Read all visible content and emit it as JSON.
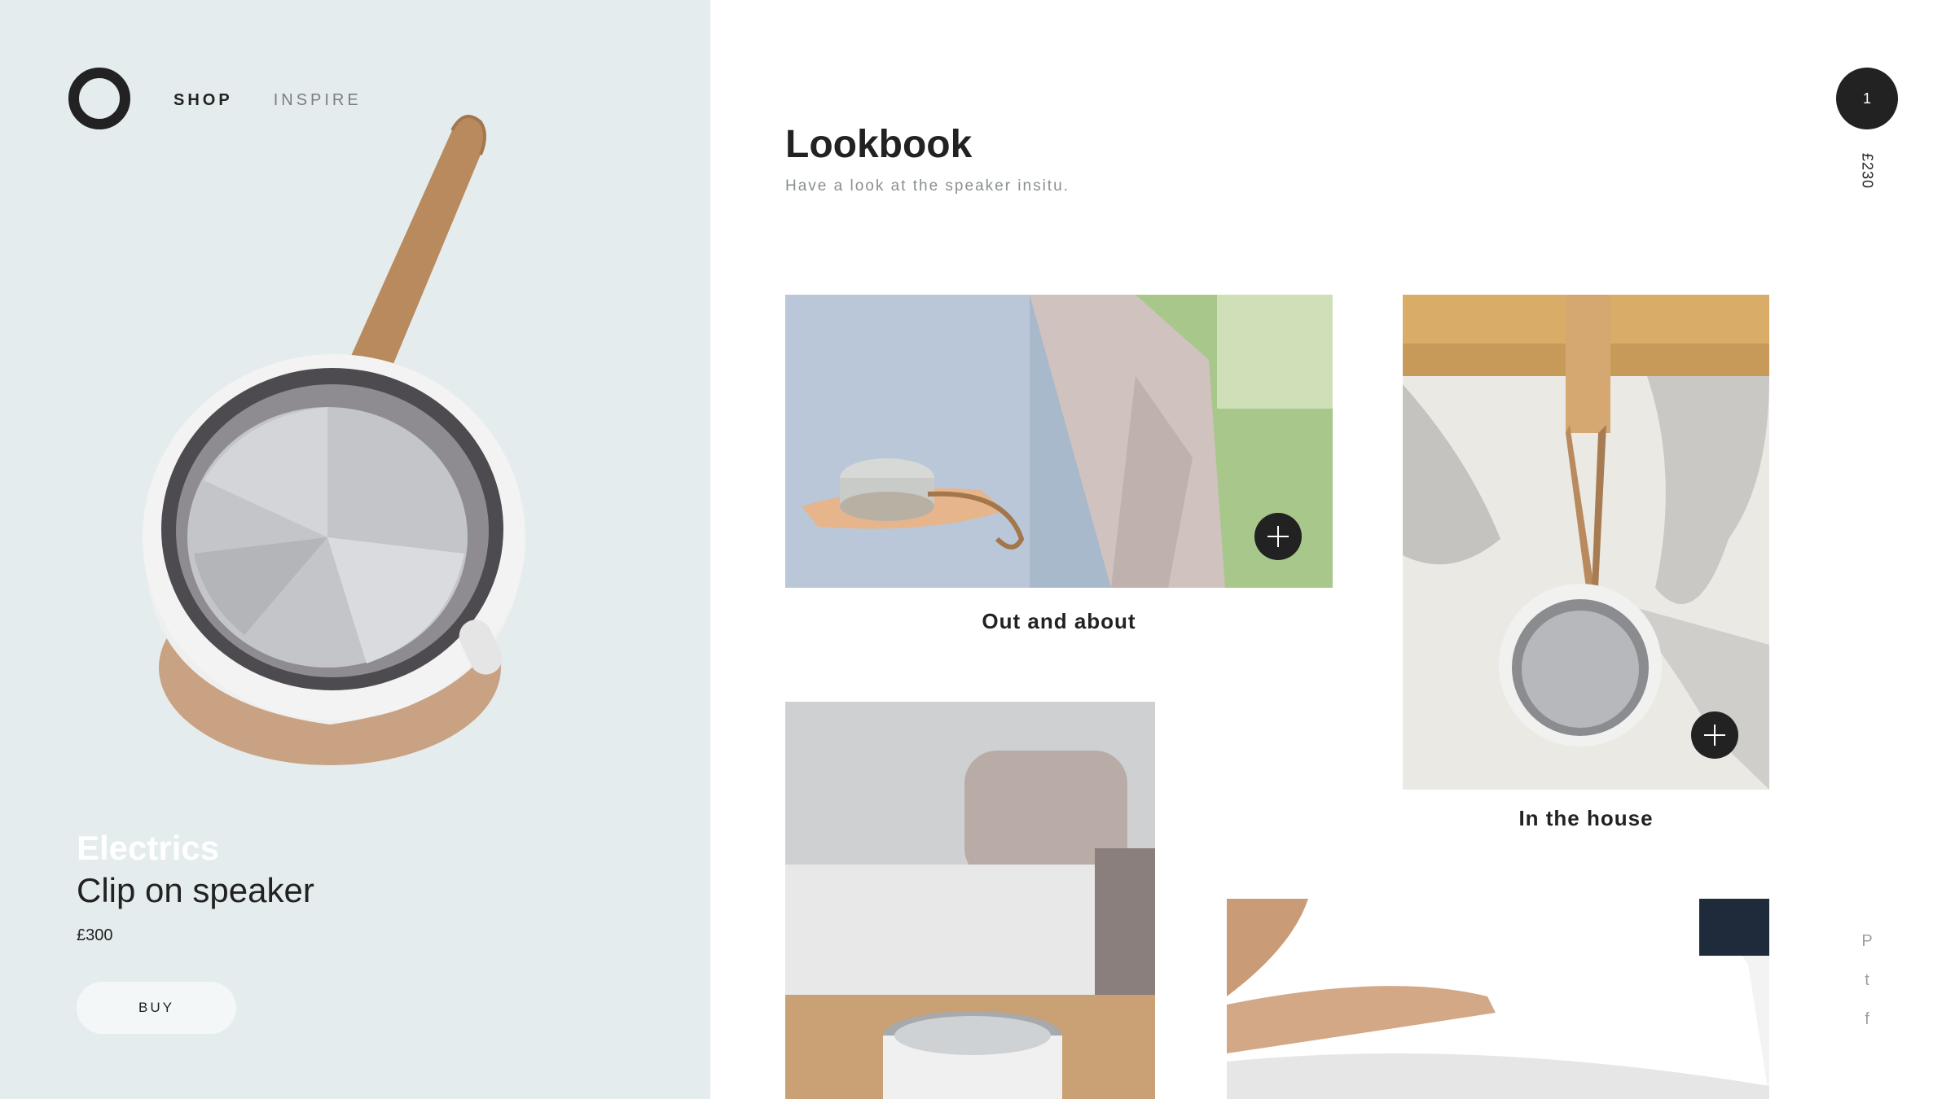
{
  "nav": {
    "shop": "SHOP",
    "inspire": "INSPIRE"
  },
  "product": {
    "category": "Electrics",
    "name": "Clip on speaker",
    "price": "£300",
    "buy_label": "BUY"
  },
  "lookbook": {
    "title": "Lookbook",
    "subtitle": "Have a look at the speaker insitu.",
    "cards": [
      {
        "caption": "Out and about"
      },
      {
        "caption": "In the house"
      },
      {
        "caption": ""
      },
      {
        "caption": ""
      }
    ]
  },
  "cart": {
    "count": "1",
    "total": "£230"
  },
  "social": {
    "pinterest_glyph": "P",
    "twitter_glyph": "t",
    "facebook_glyph": "f"
  },
  "colors": {
    "panel_bg": "#e4ecee",
    "dark": "#222222",
    "accent_leather": "#b98a5e",
    "muted": "#8a8f92"
  },
  "icons": [
    "logo-ring-icon",
    "plus-icon",
    "pinterest-icon",
    "twitter-icon",
    "facebook-icon"
  ]
}
